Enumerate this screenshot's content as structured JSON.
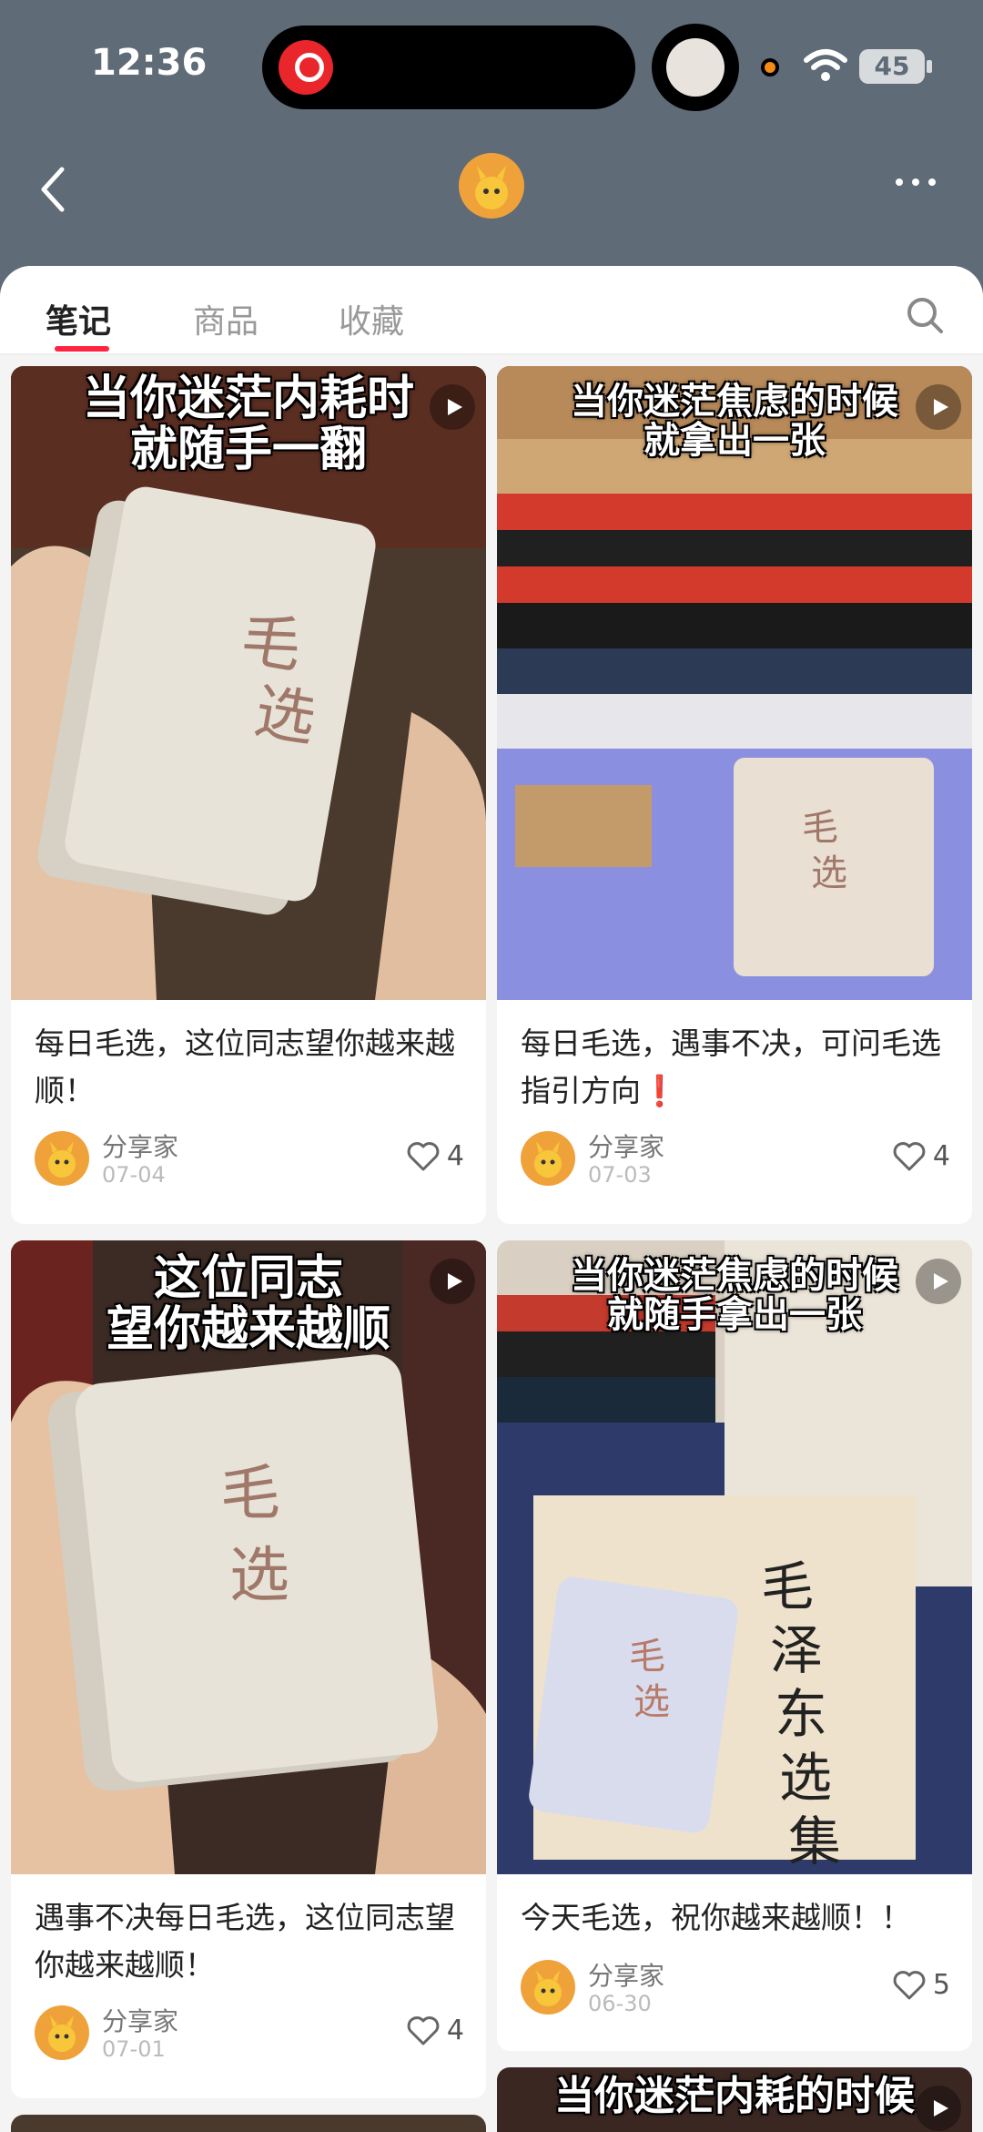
{
  "status_bar": {
    "time": "12:36",
    "battery": "45"
  },
  "tabs": [
    {
      "label": "笔记",
      "active": true
    },
    {
      "label": "商品",
      "active": false
    },
    {
      "label": "收藏",
      "active": false
    }
  ],
  "notes": [
    {
      "caption_line1": "当你迷茫内耗时",
      "caption_line2": "就随手一翻",
      "title": "每日毛选，这位同志望你越来越顺！",
      "title_mark": "",
      "author": "分享家",
      "date": "07-04",
      "likes": "4"
    },
    {
      "caption_line1": "当你迷茫焦虑的时候",
      "caption_line2": "就拿出一张",
      "title": "每日毛选，遇事不决，可问毛选指引方向",
      "title_mark": "❗",
      "author": "分享家",
      "date": "07-03",
      "likes": "4"
    },
    {
      "caption_line1": "这位同志",
      "caption_line2": "望你越来越顺",
      "title": "遇事不决每日毛选，这位同志望你越来越顺！",
      "title_mark": "",
      "author": "分享家",
      "date": "07-01",
      "likes": "4"
    },
    {
      "caption_line1": "当你迷茫焦虑的时候",
      "caption_line2": "就随手拿出一张",
      "title": "今天毛选，祝你越来越顺！！",
      "title_mark": "",
      "author": "分享家",
      "date": "06-30",
      "likes": "5"
    },
    {
      "caption_line1": "当你迷茫内耗的时候",
      "caption_line2": "",
      "title": "",
      "title_mark": "",
      "author": "",
      "date": "",
      "likes": ""
    }
  ],
  "colors": {
    "accent": "#ff2442",
    "header_bg": "#5f6b77"
  },
  "icons": [
    "back-icon",
    "more-icon",
    "search-icon",
    "play-icon",
    "heart-icon"
  ]
}
